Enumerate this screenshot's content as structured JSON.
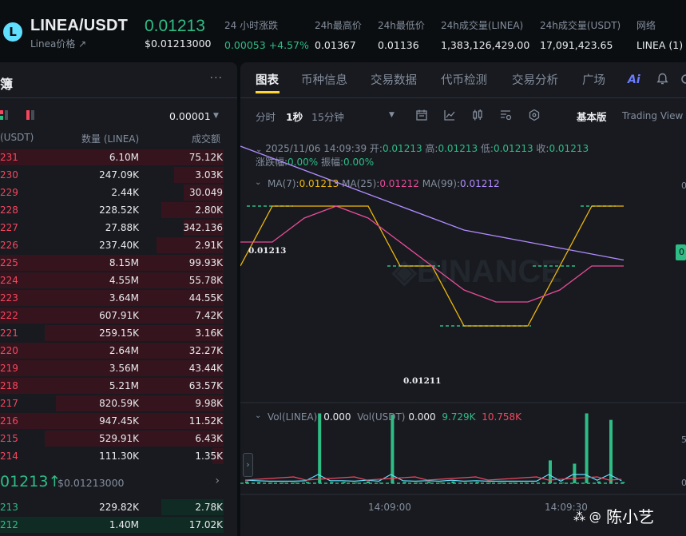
{
  "header": {
    "logo_letter": "L",
    "pair": "LINEA/USDT",
    "pair_sub": "Linea价格 ↗",
    "price": "0.01213",
    "price_usd": "$0.01213000",
    "stats": [
      {
        "label": "24 小时涨跌",
        "value": "0.00053 +4.57%"
      },
      {
        "label": "24h最高价",
        "value": "0.01367"
      },
      {
        "label": "24h最低价",
        "value": "0.01136"
      },
      {
        "label": "24h成交量(LINEA)",
        "value": "1,383,126,429.00"
      },
      {
        "label": "24h成交量(USDT)",
        "value": "17,091,423.65"
      },
      {
        "label": "网络",
        "value": "LINEA (1)"
      }
    ]
  },
  "orderbook": {
    "title": "簿",
    "more": "···",
    "precision": "0.00001",
    "col_price": "(USDT)",
    "col_qty": "数量 (LINEA)",
    "col_total": "成交额",
    "asks": [
      {
        "p": "231",
        "q": "6.10M",
        "t": "75.12K",
        "depth": 1.0
      },
      {
        "p": "230",
        "q": "247.09K",
        "t": "3.03K",
        "depth": 0.22
      },
      {
        "p": "229",
        "q": "2.44K",
        "t": "30.049",
        "depth": 0.18
      },
      {
        "p": "228",
        "q": "228.52K",
        "t": "2.80K",
        "depth": 0.28
      },
      {
        "p": "227",
        "q": "27.88K",
        "t": "342.136",
        "depth": 0.18
      },
      {
        "p": "226",
        "q": "237.40K",
        "t": "2.91K",
        "depth": 0.3
      },
      {
        "p": "225",
        "q": "8.15M",
        "t": "99.93K",
        "depth": 1.0
      },
      {
        "p": "224",
        "q": "4.55M",
        "t": "55.78K",
        "depth": 1.0
      },
      {
        "p": "223",
        "q": "3.64M",
        "t": "44.55K",
        "depth": 1.0
      },
      {
        "p": "222",
        "q": "607.91K",
        "t": "7.42K",
        "depth": 1.0
      },
      {
        "p": "221",
        "q": "259.15K",
        "t": "3.16K",
        "depth": 0.8
      },
      {
        "p": "220",
        "q": "2.64M",
        "t": "32.27K",
        "depth": 1.0
      },
      {
        "p": "219",
        "q": "3.56M",
        "t": "43.44K",
        "depth": 1.0
      },
      {
        "p": "218",
        "q": "5.21M",
        "t": "63.57K",
        "depth": 1.0
      },
      {
        "p": "217",
        "q": "820.59K",
        "t": "9.98K",
        "depth": 0.75
      },
      {
        "p": "216",
        "q": "947.45K",
        "t": "11.52K",
        "depth": 1.0
      },
      {
        "p": "215",
        "q": "529.91K",
        "t": "6.43K",
        "depth": 0.8
      },
      {
        "p": "214",
        "q": "111.30K",
        "t": "1.35K",
        "depth": 0.05
      }
    ],
    "mid_price": "01213↑",
    "mid_usd": "$0.01213000",
    "mid_chevron": "›",
    "bids": [
      {
        "p": "213",
        "q": "229.82K",
        "t": "2.78K",
        "depth": 0.28
      },
      {
        "p": "212",
        "q": "1.40M",
        "t": "17.02K",
        "depth": 1.0
      }
    ]
  },
  "chart": {
    "tabs": [
      "图表",
      "币种信息",
      "交易数据",
      "代币检测",
      "交易分析",
      "广场"
    ],
    "ai_label": "Ai",
    "toolbar": {
      "time": "分时",
      "sec1": "1秒",
      "min15": "15分钟",
      "basic": "基本版",
      "tv": "Trading View"
    },
    "ohlc": {
      "date": "2025/11/06 14:09:39",
      "open_label": "开:",
      "open": "0.01213",
      "high_label": "高:",
      "high": "0.01213",
      "low_label": "低:",
      "low": "0.01213",
      "close_label": "收:",
      "close": "0.01213",
      "chg_label": "涨跌幅:",
      "chg": "0.00%",
      "amp_label": "振幅:",
      "amp": "0.00%"
    },
    "ma": {
      "ma7_label": "MA(7):",
      "ma7": "0.01213",
      "ma25_label": "MA(25):",
      "ma25": "0.01212",
      "ma99_label": "MA(99):",
      "ma99": "0.01212"
    },
    "vol": {
      "label": "Vol(LINEA):",
      "value": "0.000",
      "label2": "Vol(USDT)",
      "value2": "0.000",
      "v3": "9.729K",
      "v4": "10.758K"
    },
    "price_label_high": "0.01213",
    "price_label_low": "0.01211",
    "x_ticks": [
      "14:09:00",
      "14:09:30"
    ],
    "y_ticks": [
      "0",
      "5",
      "0"
    ],
    "price_tag": "0",
    "colors": {
      "up": "#2ebd85",
      "down": "#f6465d",
      "ma7": "#f0b90b",
      "ma25": "#e84c98",
      "ma99": "#b18cff"
    }
  },
  "chart_data": {
    "type": "line",
    "title": "",
    "series": [
      {
        "name": "MA(7)",
        "values": [
          0.01212,
          0.01213,
          0.01213,
          0.01213,
          0.01213,
          0.01212,
          0.01212,
          0.01211,
          0.01211,
          0.01211,
          0.01212,
          0.01213,
          0.01213
        ]
      },
      {
        "name": "MA(25)",
        "values": [
          0.012124,
          0.012124,
          0.012128,
          0.01213,
          0.012128,
          0.012124,
          0.01212,
          0.012116,
          0.012114,
          0.012114,
          0.012116,
          0.01212,
          0.01212
        ]
      },
      {
        "name": "MA(99)",
        "values": [
          0.01214,
          0.012138,
          0.012136,
          0.012134,
          0.012132,
          0.01213,
          0.012128,
          0.012126,
          0.012125,
          0.012124,
          0.012123,
          0.012122,
          0.012121
        ]
      }
    ],
    "volume": [
      0.3,
      0.2,
      0.1,
      0.1,
      0.1,
      0.2,
      10.7,
      0.2,
      0.2,
      0.1,
      0.3,
      0.1,
      10.5,
      0.2,
      0.1,
      0.2,
      0.1,
      0.3,
      0.1,
      0.2,
      0.1,
      0.1,
      0.1,
      0.1,
      0.1,
      3.5,
      0.1,
      3.0,
      10.7,
      0.3,
      9.7,
      0.2
    ]
  },
  "watermark": {
    "text": "陈小艺",
    "prefix": "⁂ @"
  }
}
